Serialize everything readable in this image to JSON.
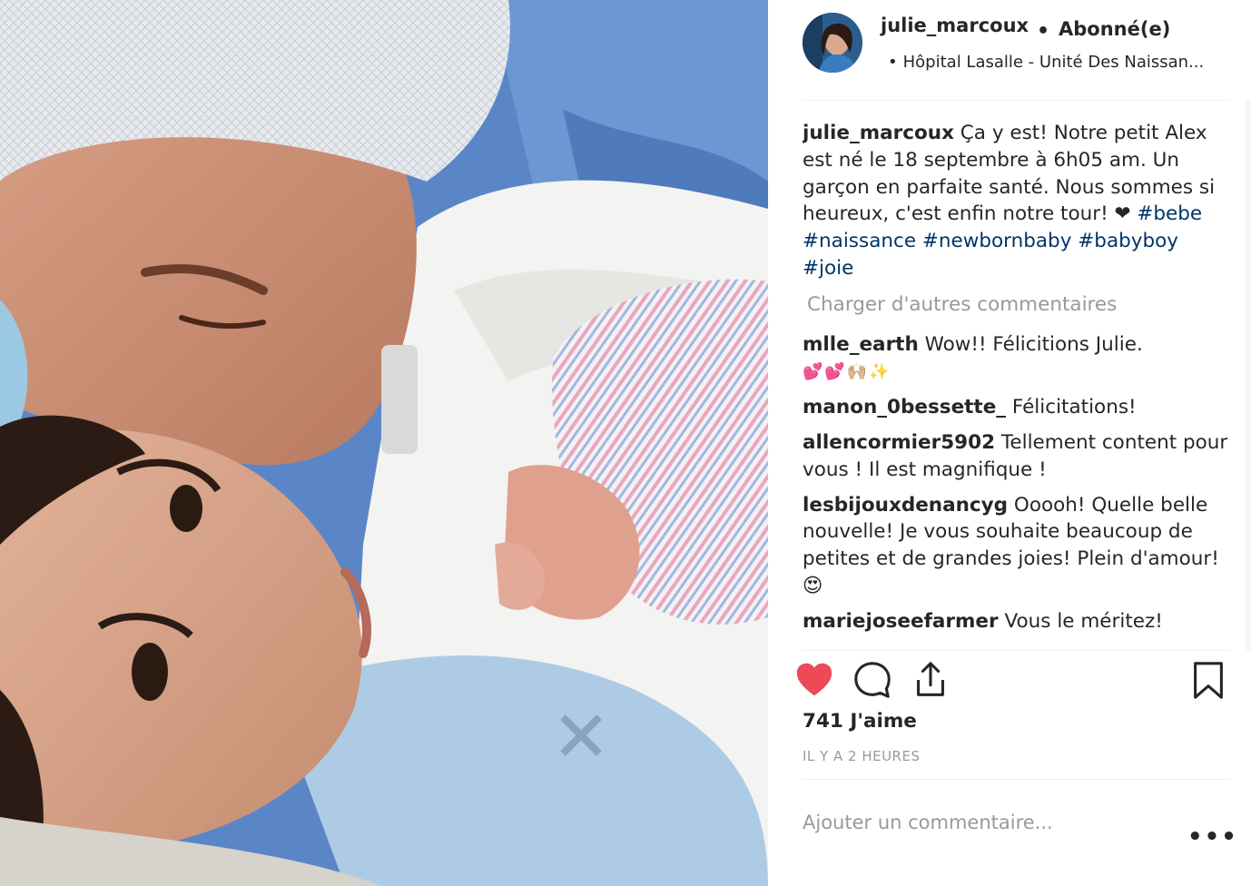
{
  "post": {
    "username": "julie_marcoux",
    "follow_label": "Abonné(e)",
    "separator": "•",
    "location_bullet": "•",
    "location": "Hôpital Lasalle - Unité Des Naissan..."
  },
  "caption": {
    "author": "julie_marcoux",
    "text": "Ça y est! Notre petit Alex est né le 18 septembre à 6h05 am. Un garçon en parfaite santé. Nous sommes si heureux, c'est enfin notre tour! ❤ ",
    "hashtags": [
      "#bebe",
      "#naissance",
      "#newbornbaby",
      "#babyboy",
      "#joie"
    ]
  },
  "load_more_label": "Charger d'autres commentaires",
  "comments": [
    {
      "author": "mlle_earth",
      "text": "Wow!! Félicitions Julie.",
      "emoji": "💕💕🙌🏼✨"
    },
    {
      "author": "manon_0bessette_",
      "text": "Félicitations!"
    },
    {
      "author": "allencormier5902",
      "text": "Tellement content pour vous ! Il est magnifique !"
    },
    {
      "author": "lesbijouxdenancyg",
      "text": "Ooooh! Quelle belle nouvelle! Je vous souhaite beaucoup de petites et de grandes joies! Plein d'amour! 😍"
    },
    {
      "author": "mariejoseefarmer",
      "text": "Vous le méritez!"
    }
  ],
  "likes_label": "741 J'aime",
  "time_label": "IL Y A 2 HEURES",
  "add_comment_placeholder": "Ajouter un commentaire...",
  "more_label": "•••",
  "icons": {
    "like": "heart-icon",
    "comment": "comment-icon",
    "share": "share-icon",
    "save": "bookmark-icon"
  },
  "colors": {
    "like_red": "#ed4956",
    "hashtag_blue": "#003569",
    "muted_gray": "#999999",
    "text": "#262626"
  }
}
